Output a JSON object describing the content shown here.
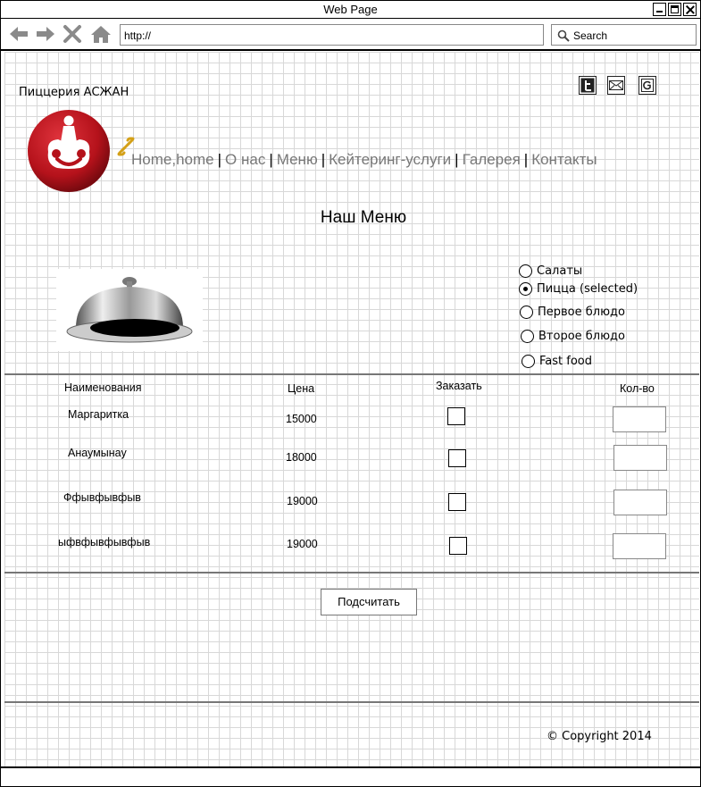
{
  "window": {
    "title": "Web Page"
  },
  "browser": {
    "url": "http://",
    "search_placeholder": "Search"
  },
  "site": {
    "brand": "Пиццерия АСЖАН",
    "social_icons": [
      "twitter-icon",
      "mail-icon",
      "google-icon"
    ]
  },
  "nav": {
    "items": [
      "Home,home",
      "О нас",
      "Меню",
      "Кейтеринг-услуги",
      "Галерея",
      "Контакты"
    ],
    "separator": "|"
  },
  "main": {
    "heading": "Наш Меню",
    "categories": [
      {
        "label": "Салаты",
        "selected": false
      },
      {
        "label": "Пицца (selected)",
        "selected": true
      },
      {
        "label": "Первое блюдо",
        "selected": false
      },
      {
        "label": "Второе блюдо",
        "selected": false
      },
      {
        "label": "Fast food",
        "selected": false
      }
    ]
  },
  "table": {
    "headers": {
      "name": "Наименования",
      "price": "Цена",
      "order": "Заказать",
      "qty": "Кол-во"
    },
    "rows": [
      {
        "name": "Маргаритка",
        "price": "15000"
      },
      {
        "name": "Анаумынау",
        "price": "18000"
      },
      {
        "name": "Ффывфывфыв",
        "price": "19000"
      },
      {
        "name": "ыфвфывфывфыв",
        "price": "19000"
      }
    ]
  },
  "actions": {
    "calculate": "Подсчитать"
  },
  "footer": {
    "copyright": "© Copyright 2014"
  },
  "colors": {
    "logo_red": "#b5121b",
    "nav_text": "#777777",
    "link_gold": "#d4a017"
  }
}
